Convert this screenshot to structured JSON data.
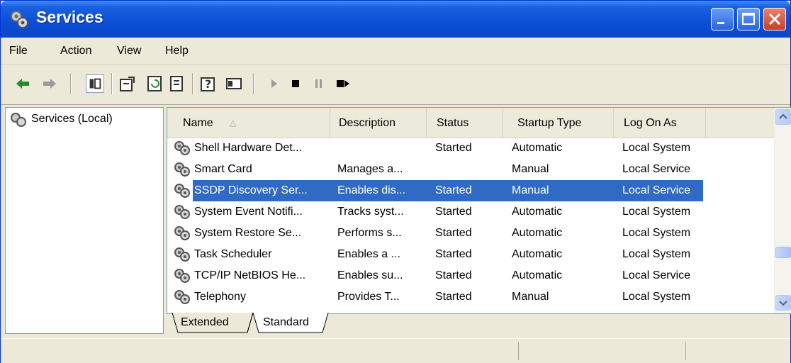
{
  "window": {
    "title": "Services"
  },
  "menu": [
    "File",
    "Action",
    "View",
    "Help"
  ],
  "tree": {
    "root_label": "Services (Local)"
  },
  "columns": [
    "Name",
    "Description",
    "Status",
    "Startup Type",
    "Log On As"
  ],
  "rows": [
    {
      "name": "Shell Hardware Det...",
      "description": "",
      "status": "Started",
      "startup": "Automatic",
      "logon": "Local System"
    },
    {
      "name": "Smart Card",
      "description": "Manages a...",
      "status": "",
      "startup": "Manual",
      "logon": "Local Service"
    },
    {
      "name": "SSDP Discovery Ser...",
      "description": "Enables dis...",
      "status": "Started",
      "startup": "Manual",
      "logon": "Local Service",
      "selected": true
    },
    {
      "name": "System Event Notifi...",
      "description": "Tracks syst...",
      "status": "Started",
      "startup": "Automatic",
      "logon": "Local System"
    },
    {
      "name": "System Restore Se...",
      "description": "Performs s...",
      "status": "Started",
      "startup": "Automatic",
      "logon": "Local System"
    },
    {
      "name": "Task Scheduler",
      "description": "Enables a ...",
      "status": "Started",
      "startup": "Automatic",
      "logon": "Local System"
    },
    {
      "name": "TCP/IP NetBIOS He...",
      "description": "Enables su...",
      "status": "Started",
      "startup": "Automatic",
      "logon": "Local Service"
    },
    {
      "name": "Telephony",
      "description": "Provides T...",
      "status": "Started",
      "startup": "Manual",
      "logon": "Local System"
    }
  ],
  "tabs": [
    "Extended",
    "Standard"
  ],
  "active_tab": "Standard",
  "colors": {
    "title_bar": "#0a4ed6",
    "selection": "#316ac5",
    "chrome": "#ece9d8"
  },
  "icons": [
    "services-icon",
    "back-arrow-icon",
    "forward-arrow-icon",
    "show-hide-tree-icon",
    "properties-icon",
    "refresh-icon",
    "export-list-icon",
    "help-icon",
    "console-icon",
    "start-service-icon",
    "stop-service-icon",
    "pause-service-icon",
    "restart-service-icon",
    "gear-service-icon"
  ]
}
